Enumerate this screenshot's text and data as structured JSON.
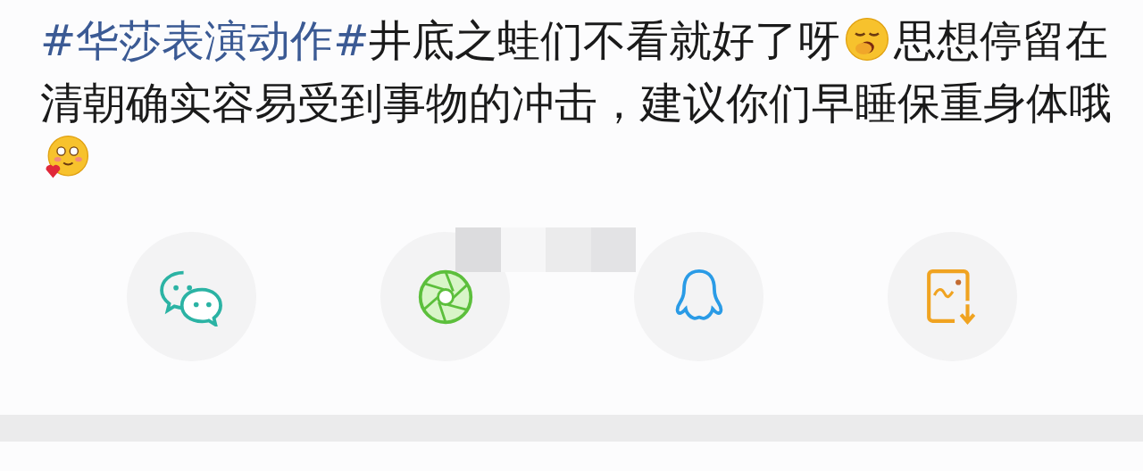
{
  "post": {
    "segments": [
      {
        "kind": "hashtag",
        "text": "#华莎表演动作#"
      },
      {
        "kind": "text",
        "text": "井底之蛙们不看就好了呀"
      },
      {
        "kind": "emoji"
      },
      {
        "kind": "text",
        "text": "思想停留在清朝确实容易受到事物的冲击，建议你们早睡保重身体哦"
      },
      {
        "kind": "emoji"
      }
    ]
  },
  "share_buttons": [
    {
      "kind": "chat"
    },
    {
      "kind": "aperture"
    },
    {
      "kind": "penguin"
    },
    {
      "kind": "save_image"
    }
  ]
}
